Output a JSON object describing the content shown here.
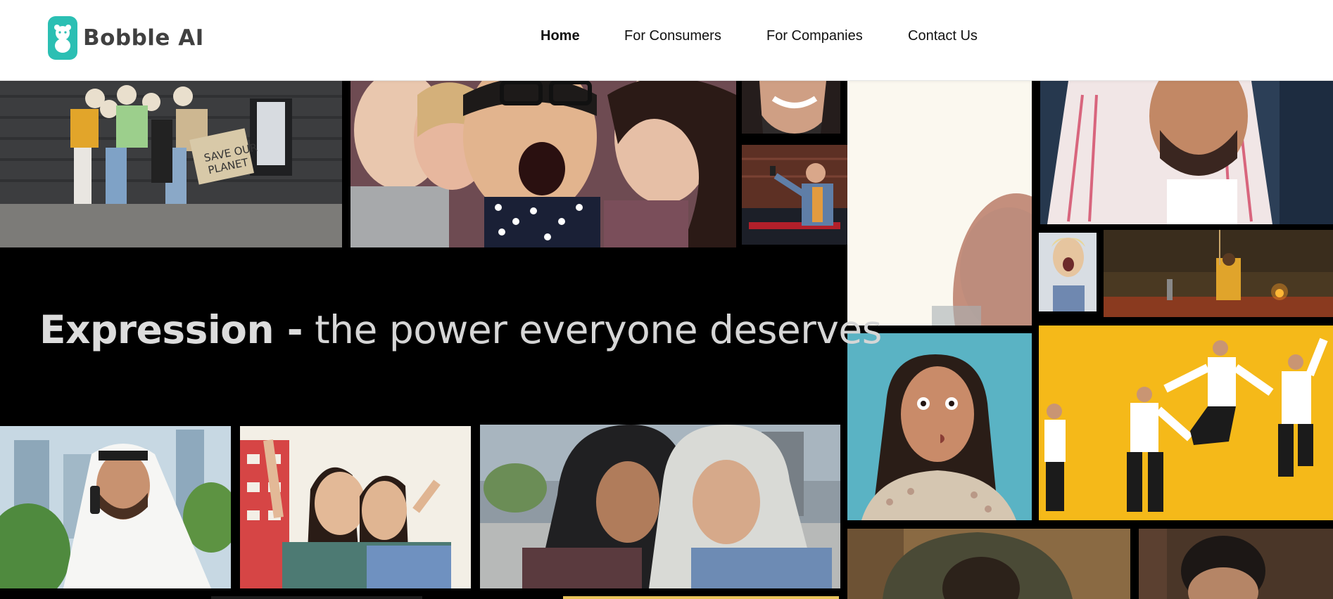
{
  "brand": {
    "name": "Bobble AI",
    "icon": "bobble-logo-icon",
    "color": "#2bbfb3"
  },
  "nav": {
    "items": [
      {
        "id": "home",
        "label": "Home",
        "active": true
      },
      {
        "id": "consumers",
        "label": "For Consumers",
        "active": false
      },
      {
        "id": "companies",
        "label": "For Companies",
        "active": false
      },
      {
        "id": "contact",
        "label": "Contact Us",
        "active": false
      }
    ]
  },
  "hero": {
    "headline_strong": "Expression -",
    "headline_light": "the power everyone deserves"
  },
  "collage": {
    "photos": [
      "protest-group-photo",
      "friends-selfie-photo",
      "woman-smiling-photo",
      "man-selfie-photo",
      "cream-background-photo",
      "man-keffiyeh-photo",
      "woman-laughing-photo",
      "temple-ritual-photo",
      "woman-shush-photo",
      "jumping-businessmen-photo",
      "man-on-phone-photo",
      "friends-peace-sign-photo",
      "women-hijab-photo",
      "hooded-person-photo",
      "man-portrait-photo"
    ],
    "accent_colors": {
      "teal": "#5ab3c4",
      "yellow": "#f5b919",
      "cream": "#fbf8ef"
    }
  }
}
